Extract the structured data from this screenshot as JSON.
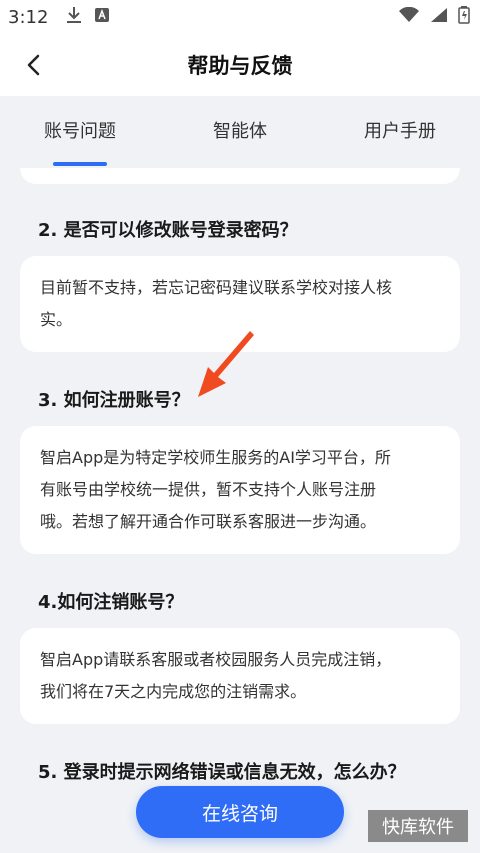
{
  "status_bar": {
    "time": "3:12"
  },
  "header": {
    "title": "帮助与反馈"
  },
  "tabs": [
    {
      "label": "账号问题",
      "active": true
    },
    {
      "label": "智能体",
      "active": false
    },
    {
      "label": "用户手册",
      "active": false
    }
  ],
  "faq": [
    {
      "question": "2. 是否可以修改账号登录密码？",
      "answer_lines": [
        "目前暂不支持，若忘记密码建议联系学校对接人核",
        "实。"
      ]
    },
    {
      "question": "3. 如何注册账号？",
      "answer_lines": [
        "智启App是为特定学校师生服务的AI学习平台，所",
        "有账号由学校统一提供，暂不支持个人账号注册",
        "哦。若想了解开通合作可联系客服进一步沟通。"
      ]
    },
    {
      "question": "4.如何注销账号？",
      "answer_lines": [
        "智启App请联系客服或者校园服务人员完成注销，",
        "我们将在7天之内完成您的注销需求。"
      ]
    },
    {
      "question": "5. 登录时提示网络错误或信息无效，怎么办？"
    }
  ],
  "consult_button": {
    "label": "在线咨询"
  },
  "watermark": {
    "text": "快库软件"
  },
  "colors": {
    "accent": "#2f6df6",
    "arrow": "#f04b20",
    "background": "#f0f2f5"
  }
}
